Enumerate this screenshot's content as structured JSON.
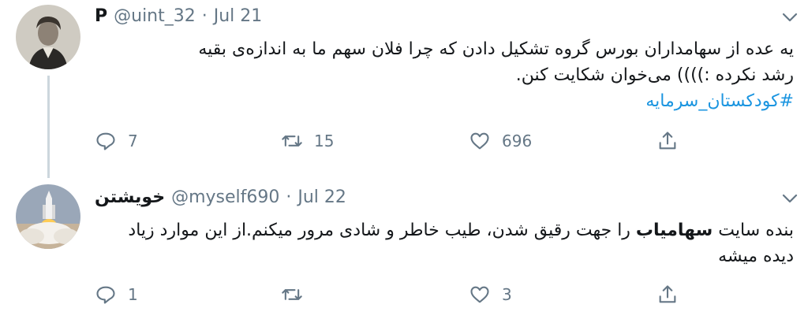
{
  "tweets": [
    {
      "name": "P",
      "handle": "@uint_32",
      "separator": "·",
      "date": "Jul 21",
      "text_line1": "یه عده از سهامداران بورس گروه تشکیل دادن که چرا فلان سهم ما به اندازه‌ی بقیه",
      "text_line2": "رشد نکرده :)))) می‌خوان شکایت کنن.",
      "hashtag": "#کودکستان_سرمایه",
      "replies": "7",
      "retweets": "15",
      "likes": "696"
    },
    {
      "name": "خویشتن",
      "handle": "@myself690",
      "separator": "·",
      "date": "Jul 22",
      "text_pre": "بنده سایت ",
      "text_bold": "سهامیاب",
      "text_post": " را جهت رقیق شدن، طیب خاطر و شادی مرور میکنم.از این موارد زیاد دیده میشه",
      "replies": "1",
      "retweets": "",
      "likes": "3"
    }
  ],
  "icons": {
    "reply": "reply-icon",
    "retweet": "retweet-icon",
    "like": "heart-icon",
    "share": "share-icon",
    "caret": "chevron-down-icon"
  },
  "colors": {
    "link": "#1b95e0",
    "muted": "#657786",
    "thread": "#ccd6dd"
  }
}
